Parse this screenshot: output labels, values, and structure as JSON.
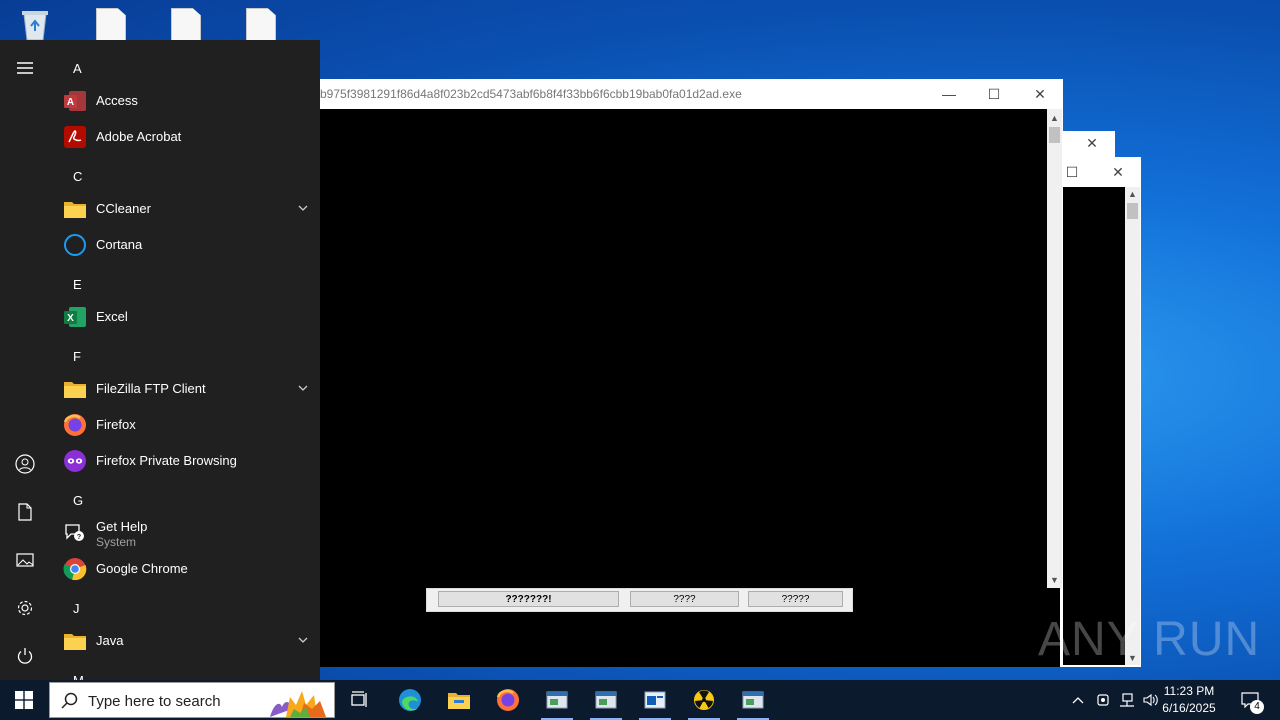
{
  "desktop": {
    "icons": [
      "recycle-bin",
      "file",
      "file",
      "file"
    ]
  },
  "main_window": {
    "title": "b975f3981291f86d4a8f023b2cd5473abf6b8f4f33bb6f6cbb19bab0fa01d2ad.exe",
    "minimize": "—",
    "maximize": "☐",
    "close": "✕"
  },
  "back_window_1": {
    "close": "✕"
  },
  "back_window_2": {
    "maximize": "☐",
    "close": "✕"
  },
  "dialog": {
    "buttons": [
      "???????!",
      "????",
      "?????"
    ]
  },
  "start_menu": {
    "rail": [
      "hamburger-icon",
      "user-icon",
      "documents-icon",
      "pictures-icon",
      "settings-icon",
      "power-icon"
    ],
    "groups": [
      {
        "letter": "A",
        "apps": [
          {
            "label": "Access",
            "icon": "access-icon"
          },
          {
            "label": "Adobe Acrobat",
            "icon": "acrobat-icon"
          }
        ]
      },
      {
        "letter": "C",
        "apps": [
          {
            "label": "CCleaner",
            "icon": "folder-icon",
            "expandable": true
          },
          {
            "label": "Cortana",
            "icon": "cortana-icon"
          }
        ]
      },
      {
        "letter": "E",
        "apps": [
          {
            "label": "Excel",
            "icon": "excel-icon"
          }
        ]
      },
      {
        "letter": "F",
        "apps": [
          {
            "label": "FileZilla FTP Client",
            "icon": "folder-icon",
            "expandable": true
          },
          {
            "label": "Firefox",
            "icon": "firefox-icon"
          },
          {
            "label": "Firefox Private Browsing",
            "icon": "firefox-private-icon"
          }
        ]
      },
      {
        "letter": "G",
        "apps": [
          {
            "label": "Get Help",
            "sublabel": "System",
            "icon": "get-help-icon"
          },
          {
            "label": "Google Chrome",
            "icon": "chrome-icon"
          }
        ]
      },
      {
        "letter": "J",
        "apps": [
          {
            "label": "Java",
            "icon": "folder-icon",
            "expandable": true
          }
        ]
      },
      {
        "letter": "M",
        "apps": []
      }
    ]
  },
  "taskbar": {
    "search_placeholder": "Type here to search",
    "pinned": [
      "task-view-icon",
      "edge-icon",
      "file-explorer-icon",
      "firefox-icon",
      "app-window-icon",
      "app-window-icon",
      "outlook-icon",
      "radiation-icon",
      "app-window-icon"
    ],
    "time": "11:23 PM",
    "date": "6/16/2025",
    "notifications_count": "4"
  },
  "watermark": "ANY RUN",
  "colors": {
    "desktop_blue": "#0a5fc8",
    "start_bg": "#202020",
    "taskbar_bg": "#0c1a2e"
  }
}
